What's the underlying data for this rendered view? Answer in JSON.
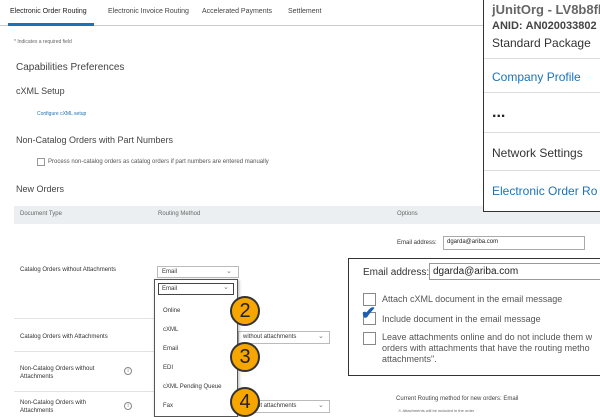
{
  "tabs": [
    "Electronic Order Routing",
    "Electronic Invoice Routing",
    "Accelerated Payments",
    "Settlement"
  ],
  "required_note": "* Indicates a required field",
  "capabilities_title": "Capabilities Preferences",
  "cxml_setup_title": "cXML Setup",
  "configure_cxml_link": "Configure cXML setup",
  "noncatalog_title": "Non-Catalog Orders with Part Numbers",
  "noncatalog_checkbox_label": "Process non-catalog orders as catalog orders if part numbers are entered manually",
  "new_orders_title": "New Orders",
  "table": {
    "headers": [
      "Document Type",
      "Routing Method",
      "Options"
    ],
    "rows": [
      "Catalog Orders without Attachments",
      "Catalog Orders with Attachments",
      "Non-Catalog Orders without Attachments",
      "Non-Catalog Orders with Attachments"
    ]
  },
  "email_address_label": "Email address:",
  "email_value": "dgarda@ariba.com",
  "routing_select_value": "Email",
  "without_attachments_value": "without attachments",
  "dropdown": {
    "selected": "Email",
    "options": [
      "Online",
      "cXML",
      "Email",
      "EDI",
      "cXML Pending Queue",
      "Fax"
    ]
  },
  "badges": [
    "2",
    "3",
    "4"
  ],
  "zoom_top": {
    "org": "jUnitOrg - LV8b8fb",
    "anid_label": "ANID:",
    "anid_value": "AN020033802",
    "package": "Standard Package",
    "company_profile": "Company Profile",
    "dots": "...",
    "network_settings": "Network Settings",
    "electronic_order": "Electronic Order Ro"
  },
  "zoom_email": {
    "label": "Email address:",
    "value": "dgarda@ariba.com",
    "options": [
      {
        "text": "Attach cXML document in the email message",
        "checked": false
      },
      {
        "text": "Include document in the email message",
        "checked": true
      },
      {
        "text": "Leave attachments online and do not include them w\norders with attachments that have the routing metho\nattachments\".",
        "checked": false
      }
    ]
  },
  "current_routing_text": "Current Routing method for new orders: Email",
  "attachment_warning": "Attachments will be included in the order",
  "colors": {
    "accent": "#1a73b8",
    "badge": "#f7a600",
    "check": "#1a5fb4"
  }
}
